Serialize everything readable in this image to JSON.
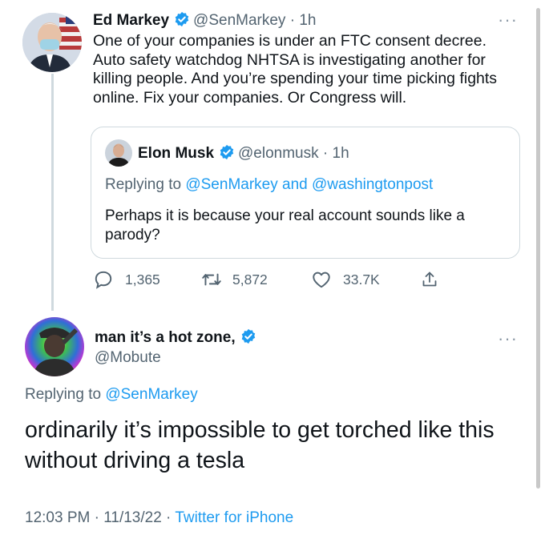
{
  "tweet": {
    "author_name": "Ed Markey",
    "author_handle": "@SenMarkey",
    "time": "1h",
    "text": "One of your companies is under an FTC consent decree. Auto safety watchdog NHTSA is investigating another for killing people. And you’re spending your time picking fights online. Fix your companies. Or Congress will.",
    "more_label": "···"
  },
  "quoted": {
    "author_name": "Elon Musk",
    "author_handle": "@elonmusk",
    "time": "1h",
    "replying_prefix": "Replying to",
    "replying_user1": "@SenMarkey",
    "replying_and": "and",
    "replying_user2": "@washingtonpost",
    "text": "Perhaps it is because your real account sounds like a parody?"
  },
  "actions": {
    "replies": "1,365",
    "retweets": "5,872",
    "likes": "33.7K",
    "icons": [
      "reply-icon",
      "retweet-icon",
      "like-icon",
      "share-icon"
    ]
  },
  "reply": {
    "author_name": "man it’s a hot zone,",
    "author_handle": "@Mobute",
    "replying_prefix": "Replying to",
    "replying_user": "@SenMarkey",
    "text": "ordinarily it’s impossible to get torched like this without driving a tesla",
    "timestamp_time": "12:03 PM",
    "timestamp_date": "11/13/22",
    "source": "Twitter for iPhone",
    "more_label": "···"
  },
  "colors": {
    "accent": "#1d9bf0",
    "secondary_text": "#536471",
    "border": "#cfd9de"
  }
}
